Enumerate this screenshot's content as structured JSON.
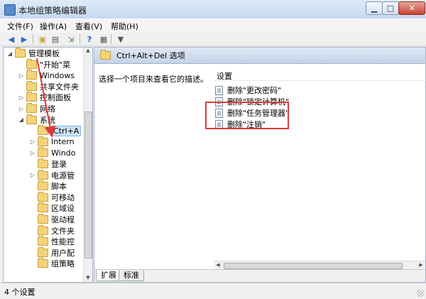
{
  "window": {
    "title": "本地组策略编辑器"
  },
  "menu": [
    "文件(F)",
    "操作(A)",
    "查看(V)",
    "帮助(H)"
  ],
  "toolbar_icons": [
    "back-arrow-icon",
    "forward-arrow-icon",
    "up-folder-icon",
    "show-tree-icon",
    "export-icon",
    "help-icon",
    "view-icon",
    "filter-icon"
  ],
  "tree": {
    "items": [
      {
        "label": "管理模板",
        "expander": "◢",
        "depth": 1
      },
      {
        "label": "\"开始\"菜",
        "expander": "",
        "depth": 2
      },
      {
        "label": "Windows",
        "expander": "▷",
        "depth": 2
      },
      {
        "label": "共享文件夹",
        "expander": "",
        "depth": 2
      },
      {
        "label": "控制面板",
        "expander": "▷",
        "depth": 2
      },
      {
        "label": "网络",
        "expander": "▷",
        "depth": 2
      },
      {
        "label": "系统",
        "expander": "◢",
        "depth": 2
      },
      {
        "label": "Ctrl+A",
        "expander": "",
        "depth": 3
      },
      {
        "label": "Intern",
        "expander": "▷",
        "depth": 3
      },
      {
        "label": "Windo",
        "expander": "▷",
        "depth": 3
      },
      {
        "label": "登录",
        "expander": "",
        "depth": 3
      },
      {
        "label": "电源管",
        "expander": "▷",
        "depth": 3
      },
      {
        "label": "脚本",
        "expander": "",
        "depth": 3
      },
      {
        "label": "可移动",
        "expander": "",
        "depth": 3
      },
      {
        "label": "区域设",
        "expander": "",
        "depth": 3
      },
      {
        "label": "驱动程",
        "expander": "",
        "depth": 3
      },
      {
        "label": "文件夹",
        "expander": "",
        "depth": 3
      },
      {
        "label": "性能控",
        "expander": "",
        "depth": 3
      },
      {
        "label": "用户配",
        "expander": "",
        "depth": 3
      },
      {
        "label": "组策略",
        "expander": "",
        "depth": 3
      }
    ],
    "selected_index": 7
  },
  "right": {
    "header": "Ctrl+Alt+Del 选项",
    "description": "选择一个项目来查看它的描述。",
    "column_header": "设置",
    "settings": [
      "删除\"更改密码\"",
      "删除\"锁定计算机\"",
      "删除\"任务管理器\"",
      "删除\"注销\""
    ],
    "highlighted_setting": "删除\"任务管理器\""
  },
  "tabs": {
    "extended": "扩展",
    "standard": "标准"
  },
  "status": "4 个设置",
  "colors": {
    "annotation": "#e03a3a",
    "selection": "#cde3f7"
  }
}
